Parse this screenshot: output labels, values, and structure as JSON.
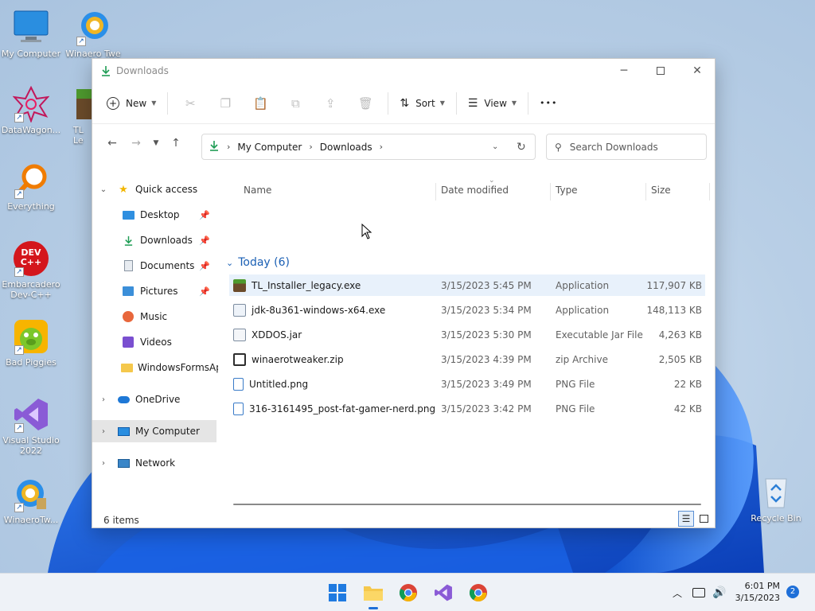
{
  "desktop": {
    "icons": [
      {
        "label": "My Computer",
        "icon": "monitor-icon"
      },
      {
        "label": "Winaero Twe",
        "icon": "winaero-icon"
      },
      {
        "label": "DataWagon...",
        "icon": "datawagon-icon"
      },
      {
        "label": "TL Le",
        "icon": "minecraft-block-icon"
      },
      {
        "label": "Everything",
        "icon": "magnifier-icon"
      },
      {
        "label": "Embarcadero Dev-C++",
        "icon": "devcpp-icon"
      },
      {
        "label": "Bad Piggies",
        "icon": "pig-icon"
      },
      {
        "label": "Visual Studio 2022",
        "icon": "visual-studio-icon"
      },
      {
        "label": "WinaeroTw...",
        "icon": "winaero-icon"
      },
      {
        "label": "Recycle Bin",
        "icon": "recycle-bin-icon"
      }
    ],
    "devcpp_badge": "DEV C++"
  },
  "window": {
    "title": "Downloads",
    "toolbar": {
      "new_label": "New",
      "sort_label": "Sort",
      "view_label": "View",
      "more_label": "•••"
    },
    "address": {
      "root": "My Computer",
      "current": "Downloads"
    },
    "search_placeholder": "Search Downloads",
    "sidebar": {
      "quick_access": "Quick access",
      "items": [
        "Desktop",
        "Downloads",
        "Documents",
        "Pictures",
        "Music",
        "Videos",
        "WindowsFormsAp"
      ],
      "onedrive": "OneDrive",
      "my_computer": "My Computer",
      "network": "Network"
    },
    "columns": {
      "name": "Name",
      "date": "Date modified",
      "type": "Type",
      "size": "Size"
    },
    "group_label": "Today (6)",
    "files": [
      {
        "name": "TL_Installer_legacy.exe",
        "date": "3/15/2023 5:45 PM",
        "type": "Application",
        "size": "117,907 KB"
      },
      {
        "name": "jdk-8u361-windows-x64.exe",
        "date": "3/15/2023 5:34 PM",
        "type": "Application",
        "size": "148,113 KB"
      },
      {
        "name": "XDDOS.jar",
        "date": "3/15/2023 5:30 PM",
        "type": "Executable Jar File",
        "size": "4,263 KB"
      },
      {
        "name": "winaerotweaker.zip",
        "date": "3/15/2023 4:39 PM",
        "type": "zip Archive",
        "size": "2,505 KB"
      },
      {
        "name": "Untitled.png",
        "date": "3/15/2023 3:49 PM",
        "type": "PNG File",
        "size": "22 KB"
      },
      {
        "name": "316-3161495_post-fat-gamer-nerd.png",
        "date": "3/15/2023 3:42 PM",
        "type": "PNG File",
        "size": "42 KB"
      }
    ],
    "status": "6 items"
  },
  "taskbar": {
    "time": "6:01 PM",
    "date": "3/15/2023",
    "notifications": "2"
  },
  "colors": {
    "accent": "#1a5fb4",
    "selection": "#e8f1fb",
    "taskbar": "#eef2f7",
    "download_green": "#1f9d55"
  }
}
